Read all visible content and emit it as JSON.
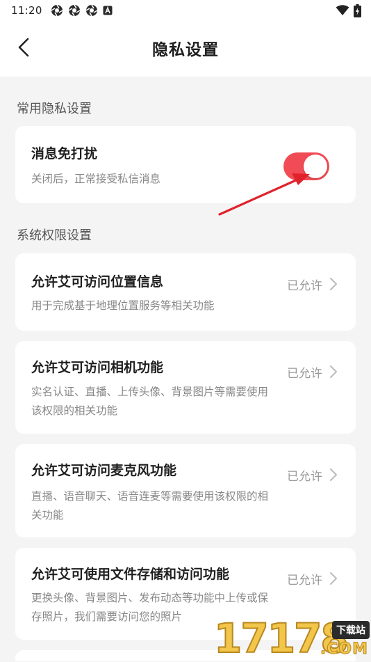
{
  "status_bar": {
    "time": "11:20",
    "icons": [
      "aperture-icon",
      "aperture-icon",
      "aperture-icon",
      "a-box-icon"
    ],
    "right_icons": [
      "wifi-icon",
      "battery-charging-icon"
    ]
  },
  "nav": {
    "title": "隐私设置",
    "back_icon": "chevron-left-icon"
  },
  "sections": {
    "common": "常用隐私设置",
    "system": "系统权限设置"
  },
  "dnd": {
    "title": "消息免打扰",
    "desc": "关闭后，正常接受私信消息",
    "enabled": true
  },
  "permissions": [
    {
      "title": "允许艾可访问位置信息",
      "desc": "用于完成基于地理位置服务等相关功能",
      "status": "已允许"
    },
    {
      "title": "允许艾可访问相机功能",
      "desc": "实名认证、直播、上传头像、背景图片等需要使用该权限的相关功能",
      "status": "已允许"
    },
    {
      "title": "允许艾可访问麦克风功能",
      "desc": "直播、语音聊天、语音连麦等需要使用该权限的相关功能",
      "status": "已允许"
    },
    {
      "title": "允许艾可使用文件存储和访问功能",
      "desc": "更换头像、背景图片、发布动态等功能中上传或保存照片，我们需要访问您的照片",
      "status": "已允许"
    }
  ],
  "watermark": {
    "digits": "17178",
    "badge": "下载站",
    "com": ".COM"
  },
  "colors": {
    "accent": "#f14c55",
    "arrow": "#e0232b",
    "background": "#f4f4f5"
  }
}
